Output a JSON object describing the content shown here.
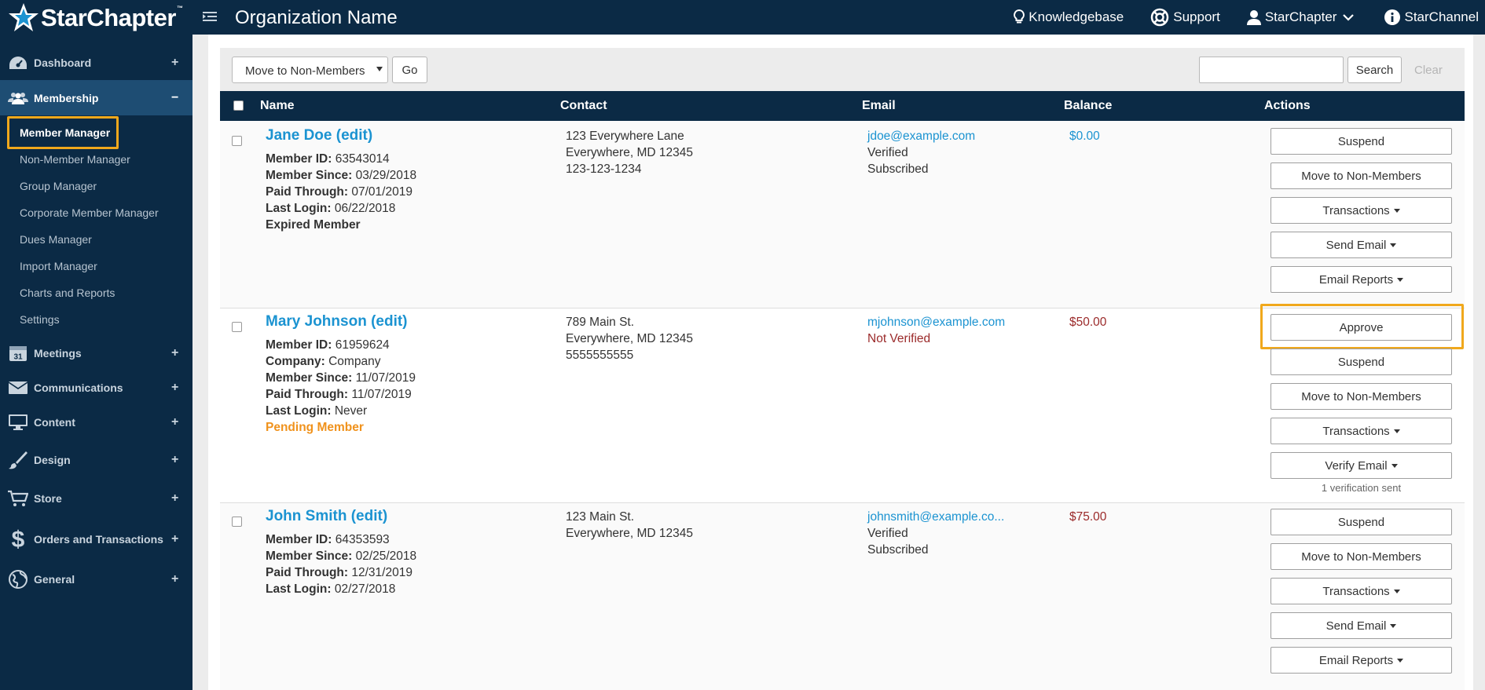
{
  "app": {
    "logo_text": "StarChapter",
    "logo_tm": "™",
    "org_name": "Organization Name"
  },
  "topnav": {
    "knowledgebase": "Knowledgebase",
    "support": "Support",
    "account": "StarChapter",
    "starchannel": "StarChannel"
  },
  "sidebar": {
    "dashboard": "Dashboard",
    "membership": "Membership",
    "sub": {
      "member_manager": "Member Manager",
      "non_member_manager": "Non-Member Manager",
      "group_manager": "Group Manager",
      "corporate_member_manager": "Corporate Member Manager",
      "dues_manager": "Dues Manager",
      "import_manager": "Import Manager",
      "charts_reports": "Charts and Reports",
      "settings": "Settings"
    },
    "meetings": "Meetings",
    "meetings_icon_day": "31",
    "communications": "Communications",
    "content": "Content",
    "design": "Design",
    "store": "Store",
    "orders": "Orders and Transactions",
    "general": "General",
    "plus": "+",
    "minus": "−"
  },
  "toolbar": {
    "bulk_action": "Move to Non-Members",
    "go": "Go",
    "search_value": "",
    "search": "Search",
    "clear": "Clear"
  },
  "table": {
    "headers": {
      "name": "Name",
      "contact": "Contact",
      "email": "Email",
      "balance": "Balance",
      "actions": "Actions"
    }
  },
  "members": [
    {
      "name": "Jane Doe (edit)",
      "member_id_label": "Member ID:",
      "member_id": "63543014",
      "member_since_label": "Member Since:",
      "member_since": "03/29/2018",
      "paid_through_label": "Paid Through:",
      "paid_through": "07/01/2019",
      "last_login_label": "Last Login:",
      "last_login": "06/22/2018",
      "status": "Expired Member",
      "contact": [
        "123 Everywhere Lane",
        "Everywhere, MD 12345",
        "123-123-1234"
      ],
      "email": "jdoe@example.com",
      "email_status": "Verified",
      "subscription": "Subscribed",
      "balance": "$0.00",
      "actions": [
        "Suspend",
        "Move to Non-Members",
        "Transactions",
        "Send Email",
        "Email Reports"
      ]
    },
    {
      "name": "Mary Johnson (edit)",
      "member_id_label": "Member ID:",
      "member_id": "61959624",
      "company_label": "Company:",
      "company": "Company",
      "member_since_label": "Member Since:",
      "member_since": "11/07/2019",
      "paid_through_label": "Paid Through:",
      "paid_through": "11/07/2019",
      "last_login_label": "Last Login:",
      "last_login": "Never",
      "status": "Pending Member",
      "contact": [
        "789 Main St.",
        "Everywhere, MD 12345",
        "5555555555"
      ],
      "email": "mjohnson@example.com",
      "email_status": "Not Verified",
      "balance": "$50.00",
      "actions": [
        "Approve",
        "Suspend",
        "Move to Non-Members",
        "Transactions",
        "Verify Email"
      ],
      "note": "1 verification sent"
    },
    {
      "name": "John Smith (edit)",
      "member_id_label": "Member ID:",
      "member_id": "64353593",
      "member_since_label": "Member Since:",
      "member_since": "02/25/2018",
      "paid_through_label": "Paid Through:",
      "paid_through": "12/31/2019",
      "last_login_label": "Last Login:",
      "last_login": "02/27/2018",
      "contact": [
        "123 Main St.",
        "Everywhere, MD 12345"
      ],
      "email": "johnsmith@example.co...",
      "email_status": "Verified",
      "subscription": "Subscribed",
      "balance": "$75.00",
      "actions": [
        "Suspend",
        "Move to Non-Members",
        "Transactions",
        "Send Email",
        "Email Reports"
      ]
    }
  ],
  "colors": {
    "navy": "#0b2a45",
    "active_nav": "#1e4d73",
    "link": "#1b93d1",
    "highlight": "#f0a81c",
    "pending": "#f0921c",
    "negative": "#9b2a2a"
  }
}
